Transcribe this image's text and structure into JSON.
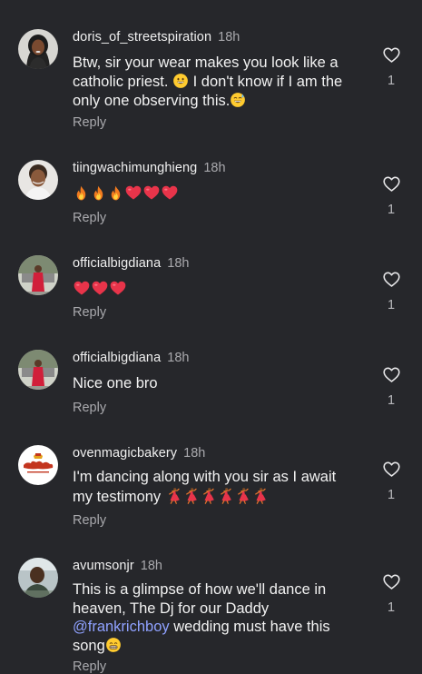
{
  "comments": [
    {
      "username": "doris_of_streetspiration",
      "time": "18h",
      "text_a": "Btw, sir your wear makes you look like a catholic priest. ",
      "text_b": " I don't know if I am the only one observing this.",
      "likes": "1",
      "reply_label": "Reply"
    },
    {
      "username": "tiingwachimunghieng",
      "time": "18h",
      "emojis": "fire fire fire heart heart heart",
      "likes": "1",
      "reply_label": "Reply"
    },
    {
      "username": "officialbigdiana",
      "time": "18h",
      "emojis": "heart heart heart",
      "likes": "1",
      "reply_label": "Reply"
    },
    {
      "username": "officialbigdiana",
      "time": "18h",
      "text": "Nice one bro",
      "likes": "1",
      "reply_label": "Reply"
    },
    {
      "username": "ovenmagicbakery",
      "time": "18h",
      "text": "I'm dancing along with you sir as I await my testimony ",
      "emojis": "dancer dancer dancer dancer dancer dancer",
      "likes": "1",
      "reply_label": "Reply"
    },
    {
      "username": "avumsonjr",
      "time": "18h",
      "text_a": "This is a glimpse of how we'll dance in heaven, The Dj for our Daddy ",
      "mention": "@frankrichboy",
      "text_b": " wedding must have this song",
      "likes": "1",
      "reply_label": "Reply"
    }
  ],
  "icons": {
    "like": "heart-outline-icon",
    "grin": "grinning-face-emoji",
    "sweat": "grinning-sweat-emoji",
    "grimace": "grimacing-face-emoji",
    "fire": "fire-emoji",
    "heart": "red-heart-emoji",
    "dancer": "dancer-emoji"
  },
  "colors": {
    "background": "#26272b",
    "text": "#f2f2f2",
    "muted": "#a9a9ad",
    "mention": "#8fa1ff",
    "heart_emoji": "#e8344a"
  }
}
